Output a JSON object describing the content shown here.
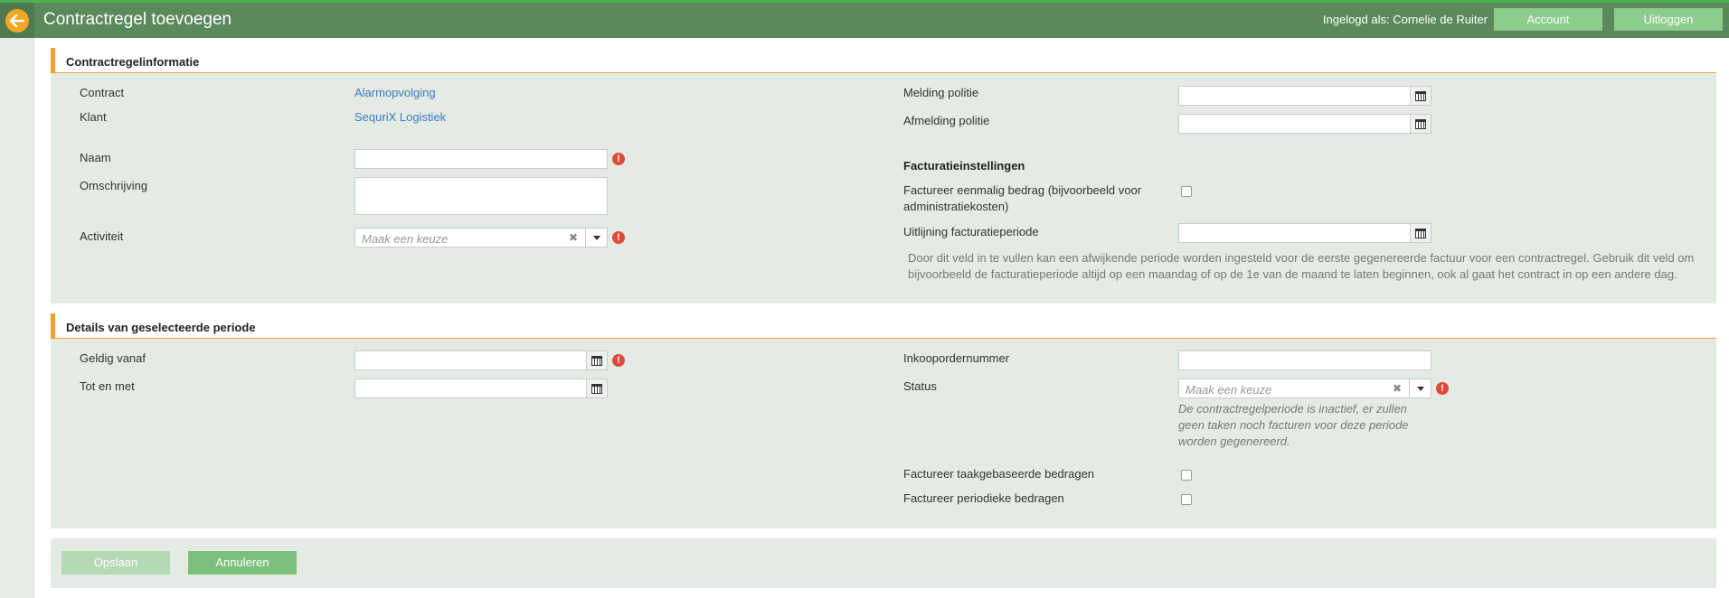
{
  "header": {
    "title": "Contractregel toevoegen",
    "login_label": "Ingelogd als: Cornelie de Ruiter",
    "account_label": "Account",
    "logout_label": "Uitloggen"
  },
  "section1": {
    "title": "Contractregelinformatie",
    "contract_label": "Contract",
    "contract_value": "Alarmopvolging",
    "klant_label": "Klant",
    "klant_value": "SequriX Logistiek",
    "naam_label": "Naam",
    "omschrijving_label": "Omschrijving",
    "activiteit_label": "Activiteit",
    "activiteit_placeholder": "Maak een keuze",
    "melding_label": "Melding politie",
    "afmelding_label": "Afmelding politie",
    "facturatie_title": "Facturatieinstellingen",
    "eenmalig_label_1": "Factureer eenmalig bedrag (bijvoorbeeld voor",
    "eenmalig_label_2": "administratiekosten)",
    "uitlijning_label": "Uitlijning facturatieperiode",
    "uitlijning_help_1": "Door dit veld in te vullen kan een afwijkende periode worden ingesteld voor de eerste gegenereerde factuur voor een contractregel. Gebruik dit veld om",
    "uitlijning_help_2": "bijvoorbeeld de facturatieperiode altijd op een maandag of op de 1e van de maand te laten beginnen, ook al gaat het contract in op een andere dag."
  },
  "section2": {
    "title": "Details van geselecteerde periode",
    "geldig_label": "Geldig vanaf",
    "totmet_label": "Tot en met",
    "inkoop_label": "Inkoopordernummer",
    "status_label": "Status",
    "status_placeholder": "Maak een keuze",
    "status_help_1": "De contractregelperiode is inactief, er zullen",
    "status_help_2": "geen taken noch facturen voor deze periode",
    "status_help_3": "worden gegenereerd.",
    "taak_label": "Factureer taakgebaseerde bedragen",
    "periodiek_label": "Factureer periodieke bedragen"
  },
  "footer": {
    "save_label": "Opslaan",
    "cancel_label": "Annuleren"
  },
  "colors": {
    "header_bg": "#5a8a5c",
    "accent_orange": "#f0a030",
    "button_green": "#7cbf7c",
    "link_blue": "#3b7abf",
    "required_red": "#e04a3a"
  }
}
